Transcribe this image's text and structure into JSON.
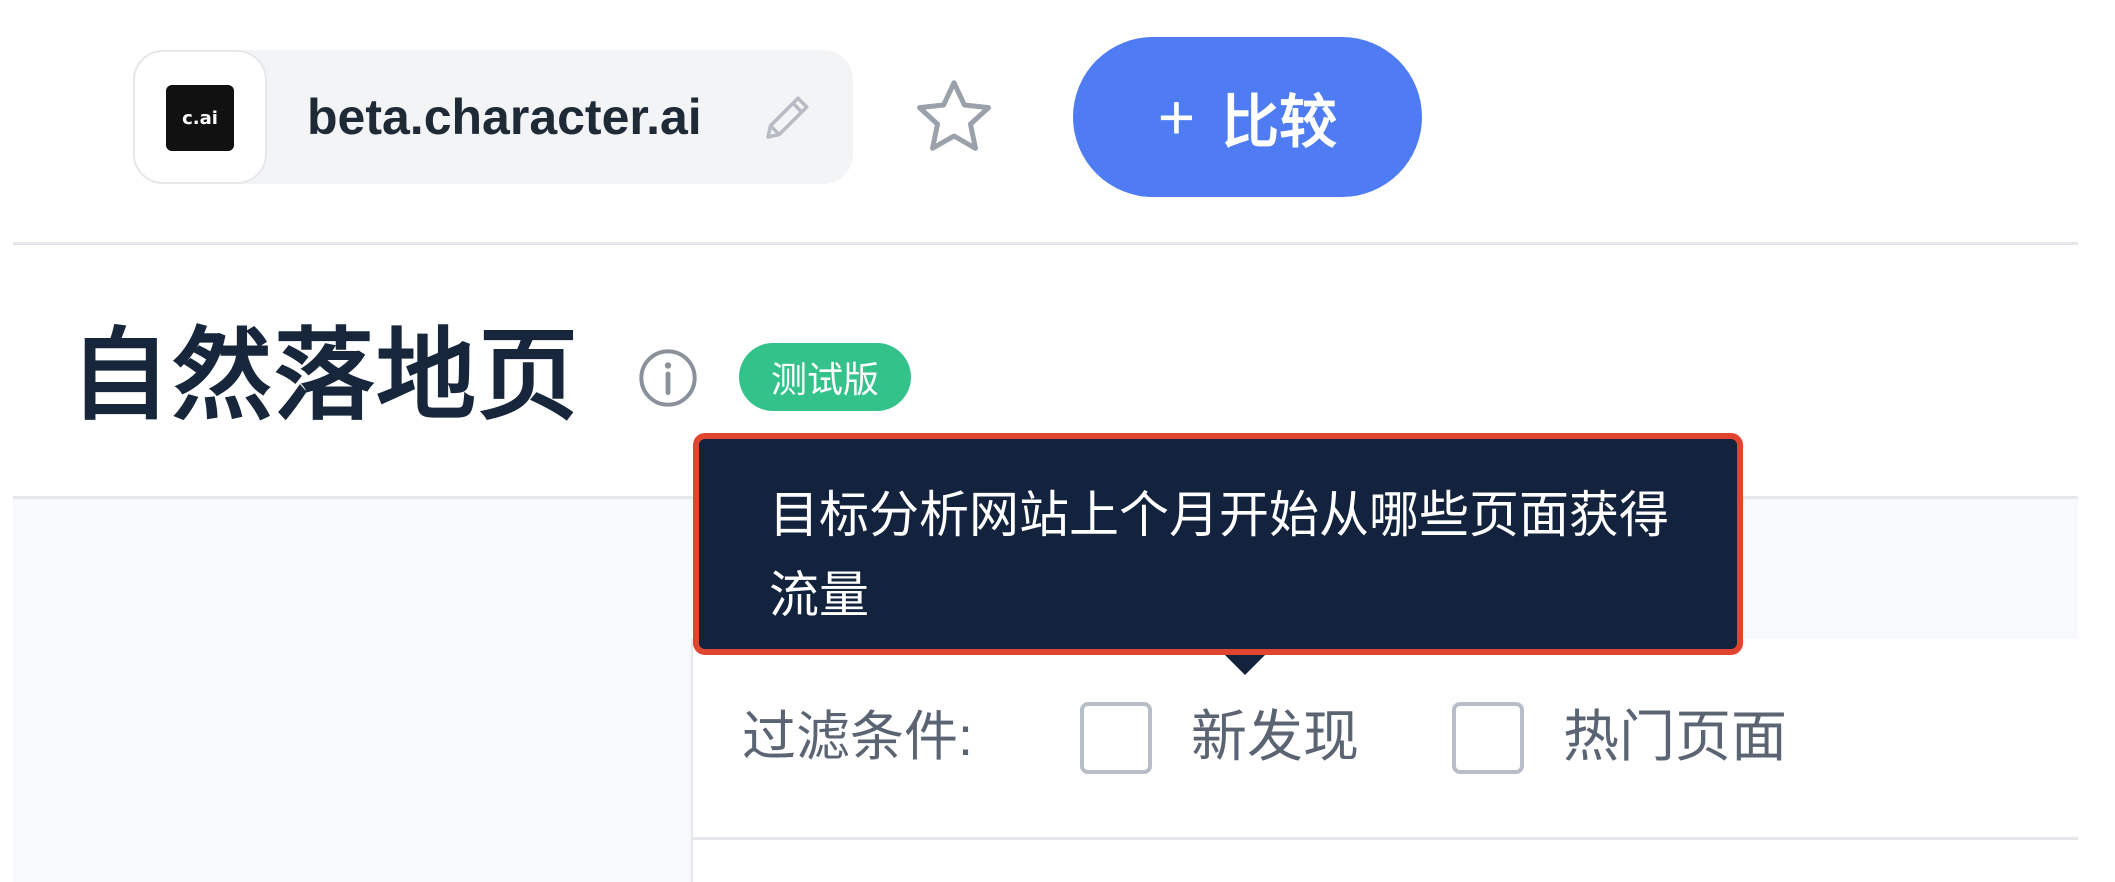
{
  "header": {
    "favicon_text": "c.ai",
    "domain": "beta.character.ai",
    "edit_icon": "pencil-icon",
    "favorite_icon": "star-outline-icon",
    "compare_button": {
      "plus": "+",
      "label": "比较"
    },
    "colors": {
      "compare_button_bg": "#4f7cf3",
      "chip_bg": "#f3f4f6"
    }
  },
  "section": {
    "title": "自然落地页",
    "info_icon": "info-circle-icon",
    "badge": "测试版",
    "badge_color": "#34c28b"
  },
  "tooltip": {
    "text": "目标分析网站上个月开始从哪些页面获得流量",
    "border_color": "#e0452f",
    "background": "#14233d"
  },
  "filters": {
    "label": "过滤条件:",
    "options": [
      {
        "label": "新发现",
        "checked": false
      },
      {
        "label": "热门页面",
        "checked": false
      }
    ]
  }
}
